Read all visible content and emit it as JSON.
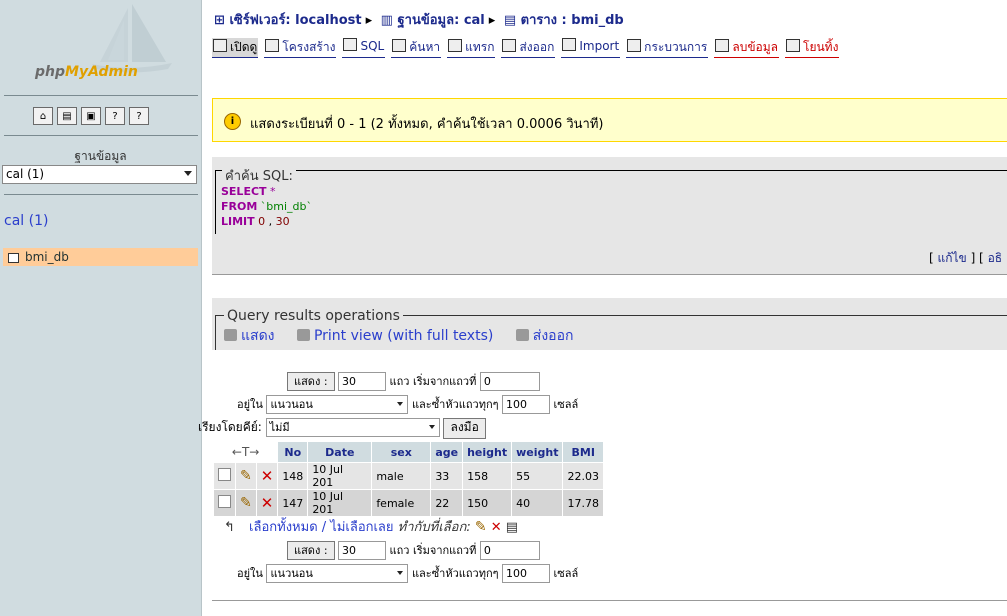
{
  "sidebar": {
    "logo": {
      "php": "php",
      "myadmin": "MyAdmin"
    },
    "db_label": "ฐานข้อมูล",
    "db_select_value": "cal (1)",
    "db_title": "cal (1)",
    "table_item": "bmi_db",
    "icons": [
      "home-icon",
      "query-window-icon",
      "sql-icon",
      "docs-icon",
      "help-icon"
    ]
  },
  "breadcrumb": {
    "server": "เซิร์ฟเวอร์: localhost",
    "database": "ฐานข้อมูล: cal",
    "table": "ตาราง : bmi_db"
  },
  "tabs": [
    {
      "label": "เปิดดู",
      "active": true
    },
    {
      "label": "โครงสร้าง"
    },
    {
      "label": "SQL"
    },
    {
      "label": "ค้นหา"
    },
    {
      "label": "แทรก"
    },
    {
      "label": "ส่งออก"
    },
    {
      "label": "Import"
    },
    {
      "label": "กระบวนการ"
    },
    {
      "label": "ลบข้อมูล",
      "danger": true
    },
    {
      "label": "โยนทิ้ง",
      "danger": true
    }
  ],
  "notice": "แสดงระเบียนที่ 0 - 1 (2 ทั้งหมด, คำค้นใช้เวลา 0.0006 วินาที)",
  "sql_box": {
    "legend": "คำค้น SQL:",
    "line1_kw": "SELECT",
    "line1_rest": "*",
    "line2_kw": "FROM",
    "line2_rest": "`bmi_db`",
    "line3_kw": "LIMIT",
    "line3_a": "0",
    "line3_b": "30"
  },
  "edit_links": {
    "edit": "แก้ไข",
    "explain": "อธิ"
  },
  "query_ops": {
    "legend": "Query results operations",
    "show": "แสดง",
    "print": "Print view (with full texts)",
    "export": "ส่งออก"
  },
  "nav": {
    "show_button": "แสดง :",
    "rows": "30",
    "rows_label": "แถว เริ่มจากแถวที่",
    "start": "0",
    "in_label": "อยู่ใน",
    "mode": "แนวนอน",
    "repeat_label": "และซ้ำหัวแถวทุกๆ",
    "repeat": "100",
    "cells_label": "เซลล์",
    "sort_label": "เรียงโดยคีย์:",
    "sort_value": "ไม่มี",
    "go_button": "ลงมือ"
  },
  "table": {
    "columns": [
      "No",
      "Date",
      "sex",
      "age",
      "height",
      "weight",
      "BMI"
    ],
    "arrows": "←T→",
    "rows": [
      [
        "148",
        "10 Jul 201",
        "male",
        "33",
        "158",
        "55",
        "22.03"
      ],
      [
        "147",
        "10 Jul 201",
        "female",
        "22",
        "150",
        "40",
        "17.78"
      ]
    ]
  },
  "select_all": {
    "check": "เลือกทั้งหมด",
    "sep": " / ",
    "uncheck": "ไม่เลือกเลย",
    "with_selected": "ทำกับที่เลือก:"
  }
}
